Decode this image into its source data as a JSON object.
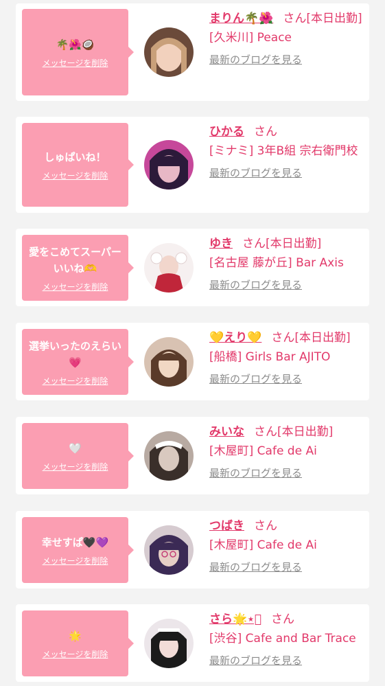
{
  "delete_label": "メッセージを削除",
  "blog_label": "最新のブログを見る",
  "san_label": "さん",
  "colors": {
    "background": "#f3f3f3",
    "card": "#ffffff",
    "bubble": "#fb9eb2",
    "accent": "#e2396a",
    "link_gray": "#8c8c8c"
  },
  "items": [
    {
      "message": "🌴🌺🥥",
      "name": "まりん🌴🌺",
      "status": "[本日出勤]",
      "shop": "[久米川] Peace",
      "avatar_colors": [
        "#f2d1bd",
        "#6b4a3a"
      ]
    },
    {
      "message": "しゅぱいね！",
      "name": "ひかる",
      "status": "",
      "shop": "[ミナミ] 3年B組 宗右衛門校",
      "avatar_colors": [
        "#c6489a",
        "#2c1a3a"
      ]
    },
    {
      "message": "愛をこめてスーパーいいね🫶",
      "name": "ゆき",
      "status": "[本日出勤]",
      "shop": "[名古屋 藤が丘] Bar Axis",
      "avatar_colors": [
        "#f6f0f0",
        "#c0263a"
      ]
    },
    {
      "message": "選挙いったのえらい💗",
      "name": "💛えり💛",
      "status": "[本日出勤]",
      "shop": "[船橋] Girls Bar AJITO",
      "avatar_colors": [
        "#f1d8c4",
        "#5a3b2a"
      ]
    },
    {
      "message": "🤍",
      "name": "みいな",
      "status": "[本日出勤]",
      "shop": "[木屋町] Cafe de Ai",
      "avatar_colors": [
        "#d9c9bf",
        "#3a2f2a"
      ]
    },
    {
      "message": "幸せすぱ🖤💜",
      "name": "つばき",
      "status": "",
      "shop": "[木屋町] Cafe de Ai",
      "avatar_colors": [
        "#e6cfc6",
        "#3b2a55"
      ]
    },
    {
      "message": "🌟",
      "name": "さら🌟⋆͛",
      "status": "",
      "shop": "[渋谷] Cafe and Bar Trace",
      "avatar_colors": [
        "#ece6ea",
        "#1b1b1b"
      ]
    }
  ]
}
